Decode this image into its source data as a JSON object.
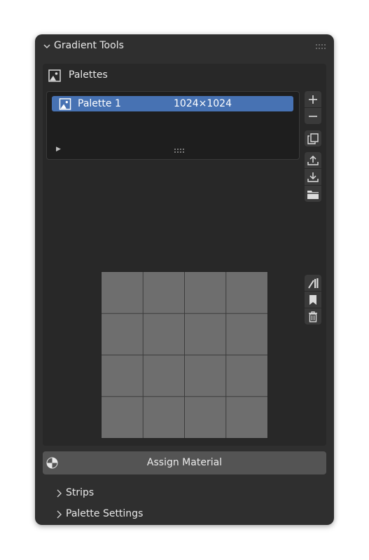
{
  "panel": {
    "title": "Gradient Tools"
  },
  "palettes": {
    "title": "Palettes",
    "items": [
      {
        "name": "Palette 1",
        "size": "1024×1024",
        "selected": true
      }
    ]
  },
  "toolbar": {
    "icons": [
      "add-icon",
      "remove-icon",
      "duplicate-icon",
      "export-icon",
      "import-icon",
      "folder-icon",
      "paint-icon",
      "bookmark-icon",
      "trash-icon"
    ]
  },
  "preview": {
    "grid_rows": 4,
    "grid_cols": 4,
    "cell_color": "#6e6e6e"
  },
  "actions": {
    "assign_material": "Assign Material"
  },
  "subpanels": {
    "strips": "Strips",
    "palette_settings": "Palette Settings"
  },
  "colors": {
    "accent": "#4772b3",
    "panel_bg": "#2f2f2f",
    "button_bg": "#545454"
  }
}
